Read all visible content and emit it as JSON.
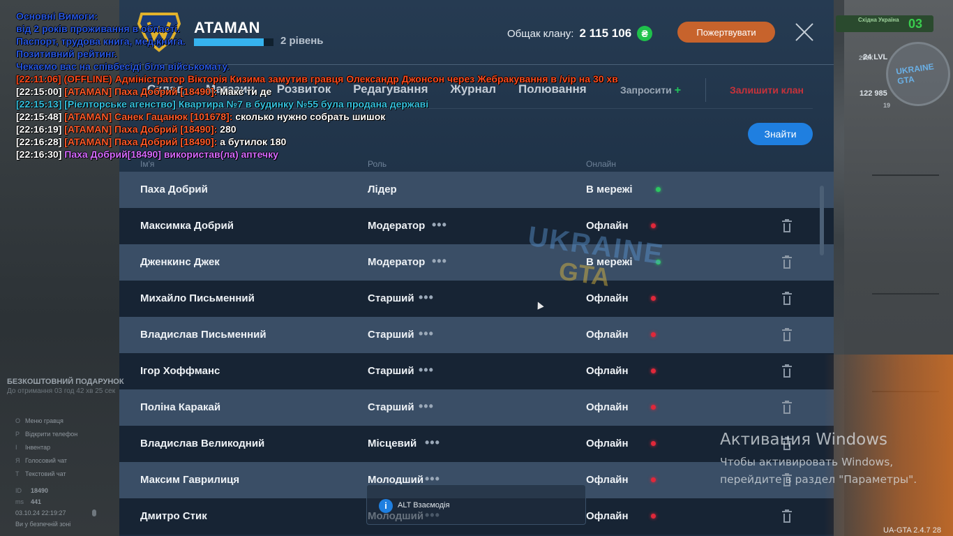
{
  "clan": {
    "name": "ATAMAN",
    "level_label": "2 рівень",
    "level_progress": 0.88,
    "bank_label": "Общак клану:",
    "bank_value": "2 115 106",
    "currency_icon": "hryvnia-coin-icon",
    "donate_label": "Пожертвувати",
    "accent_color": "#1f7fe0",
    "donate_color": "#c7632c"
  },
  "tabs": [
    {
      "label": "Склад"
    },
    {
      "label": "Магазин"
    },
    {
      "label": "Розвиток"
    },
    {
      "label": "Редагування"
    },
    {
      "label": "Журнал"
    },
    {
      "label": "Полювання"
    }
  ],
  "actions": {
    "invite_label": "Запросити",
    "leave_label": "Залишити клан",
    "find_label": "Знайти"
  },
  "table": {
    "headers": [
      "Ім'я",
      "Роль",
      "Онлайн"
    ],
    "rows": [
      {
        "name": "Паха Добрий",
        "role": "Лідер",
        "status": "В мережі",
        "online": true,
        "menu": false,
        "delete": false
      },
      {
        "name": "Максимка Добрий",
        "role": "Модератор",
        "status": "Офлайн",
        "online": false,
        "menu": true,
        "delete": true
      },
      {
        "name": "Дженкинс Джек",
        "role": "Модератор",
        "status": "В мережі",
        "online": true,
        "menu": true,
        "delete": true
      },
      {
        "name": "Михайло Письменний",
        "role": "Старший",
        "status": "Офлайн",
        "online": false,
        "menu": true,
        "delete": true
      },
      {
        "name": "Владислав Письменний",
        "role": "Старший",
        "status": "Офлайн",
        "online": false,
        "menu": true,
        "delete": true
      },
      {
        "name": "Ігор Хоффманс",
        "role": "Старший",
        "status": "Офлайн",
        "online": false,
        "menu": true,
        "delete": true
      },
      {
        "name": "Поліна Каракай",
        "role": "Старший",
        "status": "Офлайн",
        "online": false,
        "menu": true,
        "delete": true
      },
      {
        "name": "Владислав Великодний",
        "role": "Місцевий",
        "status": "Офлайн",
        "online": false,
        "menu": true,
        "delete": true
      },
      {
        "name": "Максим Гаврилиця",
        "role": "Молодший",
        "status": "Офлайн",
        "online": false,
        "menu": true,
        "delete": true
      },
      {
        "name": "Дмитро Стик",
        "role": "Молодший",
        "status": "Офлайн",
        "online": false,
        "menu": true,
        "delete": true
      }
    ]
  },
  "chat": {
    "requirements": [
      "Основні Вимоги:",
      "від 2 років проживання в області.",
      "Паспорт, трудова книга, мед.книга.",
      "Позитивний рейтинг.",
      "Чекаємо вас на співбесіді біля військомату."
    ],
    "messages": [
      {
        "time": "[22:11:06]",
        "sender": "(OFFLINE) Адміністратор Вікторія Кизима замутив гравця Олександр Джонсон через Жебракування в /vip на 30 хв",
        "text": "",
        "kind": "red"
      },
      {
        "time": "[22:15:00]",
        "sender": "[ATAMAN] Паха Добрий [18490]:",
        "text": " Макс ти де",
        "kind": "ataman"
      },
      {
        "time": "[22:15:13]",
        "sender": "[Ріелторське агенство] Квартира №7 в будинку №55 була продана державі",
        "text": "",
        "kind": "agency"
      },
      {
        "time": "[22:15:48]",
        "sender": "[ATAMAN] Санек Гацанюк [101678]:",
        "text": " сколько нужно собрать шишок",
        "kind": "ataman"
      },
      {
        "time": "[22:16:19]",
        "sender": "[ATAMAN] Паха Добрий [18490]:",
        "text": " 280",
        "kind": "ataman"
      },
      {
        "time": "[22:16:28]",
        "sender": "[ATAMAN] Паха Добрий [18490]:",
        "text": " а бутилок 180",
        "kind": "ataman"
      },
      {
        "time": "[22:16:30]",
        "sender": "  Паха Добрий[18490] використав(ла) аптечку",
        "text": "",
        "kind": "purple"
      }
    ]
  },
  "hud_left": {
    "gift_title": "БЕЗКОШТОВНИЙ ПОДАРУНОК",
    "gift_sub": "До отримання 03 год 42 хв 25 сек",
    "menu": [
      {
        "key": "O",
        "label": "Меню гравця"
      },
      {
        "key": "P",
        "label": "Відкрити телефон"
      },
      {
        "key": "I",
        "label": "Інвентар"
      },
      {
        "key": "Я",
        "label": "Голосовий чат"
      },
      {
        "key": "T",
        "label": "Текстовий чат"
      }
    ],
    "id_label": "ID",
    "id_value": "18490",
    "ms_label": "ms",
    "ms_value": "441",
    "datetime": "03.10.24 22:19:27",
    "zone": "Ви у безпечній зоні"
  },
  "hud_right": {
    "region": "Східна Україна",
    "region_number": "03",
    "money": "290К",
    "level": "24 LVL",
    "cash": "122 985",
    "coins": "19",
    "minimap_logo": "UKRAINE GTA"
  },
  "alt_hint": {
    "icon": "info-icon",
    "label": "ALT Взаємодія"
  },
  "watermark": {
    "title": "Активация Windows",
    "line1": "Чтобы активировать Windows,",
    "line2": "перейдите в раздел \"Параметры\"."
  },
  "version": "UA-GTA 2.4.7   28"
}
